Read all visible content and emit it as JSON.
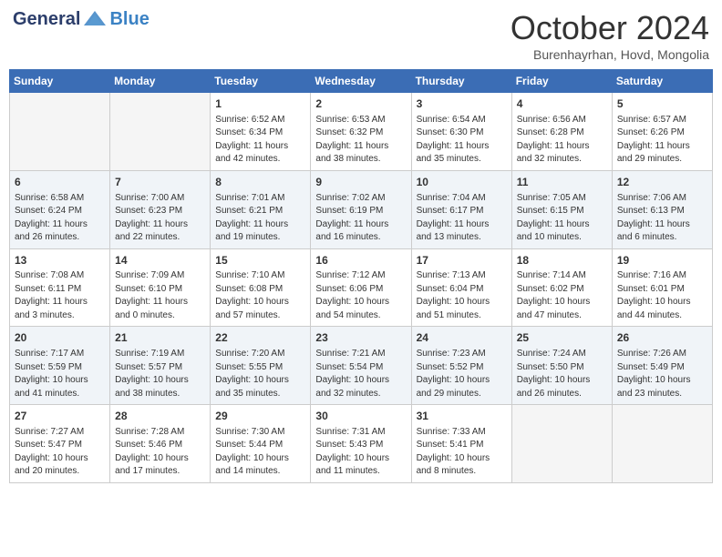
{
  "header": {
    "logo_general": "General",
    "logo_blue": "Blue",
    "month_title": "October 2024",
    "subtitle": "Burenhayrhan, Hovd, Mongolia"
  },
  "days_of_week": [
    "Sunday",
    "Monday",
    "Tuesday",
    "Wednesday",
    "Thursday",
    "Friday",
    "Saturday"
  ],
  "weeks": [
    [
      {
        "day": "",
        "empty": true
      },
      {
        "day": "",
        "empty": true
      },
      {
        "day": "1",
        "sunrise": "6:52 AM",
        "sunset": "6:34 PM",
        "daylight": "11 hours and 42 minutes."
      },
      {
        "day": "2",
        "sunrise": "6:53 AM",
        "sunset": "6:32 PM",
        "daylight": "11 hours and 38 minutes."
      },
      {
        "day": "3",
        "sunrise": "6:54 AM",
        "sunset": "6:30 PM",
        "daylight": "11 hours and 35 minutes."
      },
      {
        "day": "4",
        "sunrise": "6:56 AM",
        "sunset": "6:28 PM",
        "daylight": "11 hours and 32 minutes."
      },
      {
        "day": "5",
        "sunrise": "6:57 AM",
        "sunset": "6:26 PM",
        "daylight": "11 hours and 29 minutes."
      }
    ],
    [
      {
        "day": "6",
        "sunrise": "6:58 AM",
        "sunset": "6:24 PM",
        "daylight": "11 hours and 26 minutes."
      },
      {
        "day": "7",
        "sunrise": "7:00 AM",
        "sunset": "6:23 PM",
        "daylight": "11 hours and 22 minutes."
      },
      {
        "day": "8",
        "sunrise": "7:01 AM",
        "sunset": "6:21 PM",
        "daylight": "11 hours and 19 minutes."
      },
      {
        "day": "9",
        "sunrise": "7:02 AM",
        "sunset": "6:19 PM",
        "daylight": "11 hours and 16 minutes."
      },
      {
        "day": "10",
        "sunrise": "7:04 AM",
        "sunset": "6:17 PM",
        "daylight": "11 hours and 13 minutes."
      },
      {
        "day": "11",
        "sunrise": "7:05 AM",
        "sunset": "6:15 PM",
        "daylight": "11 hours and 10 minutes."
      },
      {
        "day": "12",
        "sunrise": "7:06 AM",
        "sunset": "6:13 PM",
        "daylight": "11 hours and 6 minutes."
      }
    ],
    [
      {
        "day": "13",
        "sunrise": "7:08 AM",
        "sunset": "6:11 PM",
        "daylight": "11 hours and 3 minutes."
      },
      {
        "day": "14",
        "sunrise": "7:09 AM",
        "sunset": "6:10 PM",
        "daylight": "11 hours and 0 minutes."
      },
      {
        "day": "15",
        "sunrise": "7:10 AM",
        "sunset": "6:08 PM",
        "daylight": "10 hours and 57 minutes."
      },
      {
        "day": "16",
        "sunrise": "7:12 AM",
        "sunset": "6:06 PM",
        "daylight": "10 hours and 54 minutes."
      },
      {
        "day": "17",
        "sunrise": "7:13 AM",
        "sunset": "6:04 PM",
        "daylight": "10 hours and 51 minutes."
      },
      {
        "day": "18",
        "sunrise": "7:14 AM",
        "sunset": "6:02 PM",
        "daylight": "10 hours and 47 minutes."
      },
      {
        "day": "19",
        "sunrise": "7:16 AM",
        "sunset": "6:01 PM",
        "daylight": "10 hours and 44 minutes."
      }
    ],
    [
      {
        "day": "20",
        "sunrise": "7:17 AM",
        "sunset": "5:59 PM",
        "daylight": "10 hours and 41 minutes."
      },
      {
        "day": "21",
        "sunrise": "7:19 AM",
        "sunset": "5:57 PM",
        "daylight": "10 hours and 38 minutes."
      },
      {
        "day": "22",
        "sunrise": "7:20 AM",
        "sunset": "5:55 PM",
        "daylight": "10 hours and 35 minutes."
      },
      {
        "day": "23",
        "sunrise": "7:21 AM",
        "sunset": "5:54 PM",
        "daylight": "10 hours and 32 minutes."
      },
      {
        "day": "24",
        "sunrise": "7:23 AM",
        "sunset": "5:52 PM",
        "daylight": "10 hours and 29 minutes."
      },
      {
        "day": "25",
        "sunrise": "7:24 AM",
        "sunset": "5:50 PM",
        "daylight": "10 hours and 26 minutes."
      },
      {
        "day": "26",
        "sunrise": "7:26 AM",
        "sunset": "5:49 PM",
        "daylight": "10 hours and 23 minutes."
      }
    ],
    [
      {
        "day": "27",
        "sunrise": "7:27 AM",
        "sunset": "5:47 PM",
        "daylight": "10 hours and 20 minutes."
      },
      {
        "day": "28",
        "sunrise": "7:28 AM",
        "sunset": "5:46 PM",
        "daylight": "10 hours and 17 minutes."
      },
      {
        "day": "29",
        "sunrise": "7:30 AM",
        "sunset": "5:44 PM",
        "daylight": "10 hours and 14 minutes."
      },
      {
        "day": "30",
        "sunrise": "7:31 AM",
        "sunset": "5:43 PM",
        "daylight": "10 hours and 11 minutes."
      },
      {
        "day": "31",
        "sunrise": "7:33 AM",
        "sunset": "5:41 PM",
        "daylight": "10 hours and 8 minutes."
      },
      {
        "day": "",
        "empty": true
      },
      {
        "day": "",
        "empty": true
      }
    ]
  ],
  "labels": {
    "sunrise": "Sunrise:",
    "sunset": "Sunset:",
    "daylight": "Daylight:"
  }
}
